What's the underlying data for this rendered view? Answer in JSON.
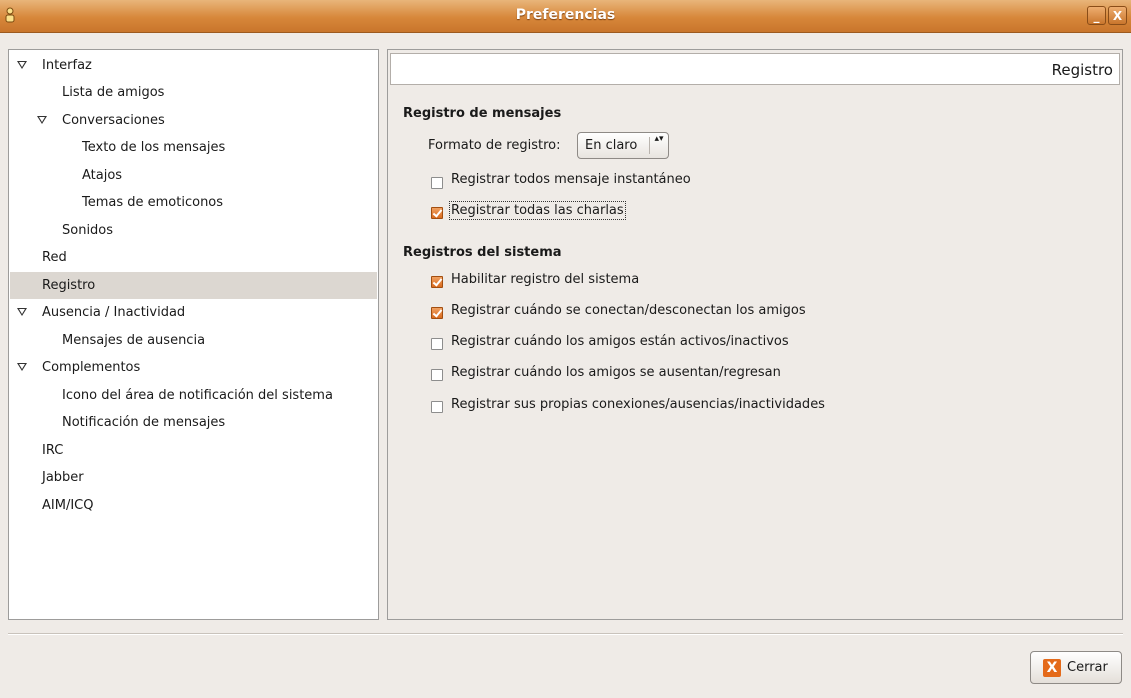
{
  "window": {
    "title": "Preferencias",
    "minimize_label": "_",
    "close_label": "X"
  },
  "tree": [
    {
      "label": "Interfaz",
      "expanded": true
    },
    {
      "label": "Lista de amigos"
    },
    {
      "label": "Conversaciones",
      "expanded": true
    },
    {
      "label": "Texto de los mensajes"
    },
    {
      "label": "Atajos"
    },
    {
      "label": "Temas de emoticonos"
    },
    {
      "label": "Sonidos"
    },
    {
      "label": "Red"
    },
    {
      "label": "Registro",
      "selected": true
    },
    {
      "label": "Ausencia / Inactividad",
      "expanded": true
    },
    {
      "label": "Mensajes de ausencia"
    },
    {
      "label": "Complementos",
      "expanded": true
    },
    {
      "label": "Icono del área de notificación del sistema"
    },
    {
      "label": "Notificación de mensajes"
    },
    {
      "label": "IRC"
    },
    {
      "label": "Jabber"
    },
    {
      "label": "AIM/ICQ"
    }
  ],
  "panel": {
    "title": "Registro",
    "messages_section": {
      "title": "Registro de mensajes",
      "format_label": "Formato de registro:",
      "format_value": "En claro",
      "format_arrows": "▴▾",
      "options": [
        {
          "label": "Registrar todos mensaje instantáneo",
          "checked": false
        },
        {
          "label": "Registrar todas las charlas",
          "checked": true
        }
      ]
    },
    "system_section": {
      "title": "Registros del sistema",
      "options": [
        {
          "label": "Habilitar registro del sistema",
          "checked": true
        },
        {
          "label": "Registrar cuándo se conectan/desconectan los amigos",
          "checked": true
        },
        {
          "label": "Registrar cuándo los amigos están activos/inactivos",
          "checked": false
        },
        {
          "label": "Registrar cuándo los amigos se ausentan/regresan",
          "checked": false
        },
        {
          "label": "Registrar sus propias conexiones/ausencias/inactividades",
          "checked": false
        }
      ]
    }
  },
  "footer": {
    "close_label": "Cerrar",
    "close_icon_glyph": "X"
  },
  "colors": {
    "titlebar": "#d7873a",
    "selection": "#dcd7d1",
    "check_accent": "#d96b1f",
    "background": "#efebe7"
  }
}
